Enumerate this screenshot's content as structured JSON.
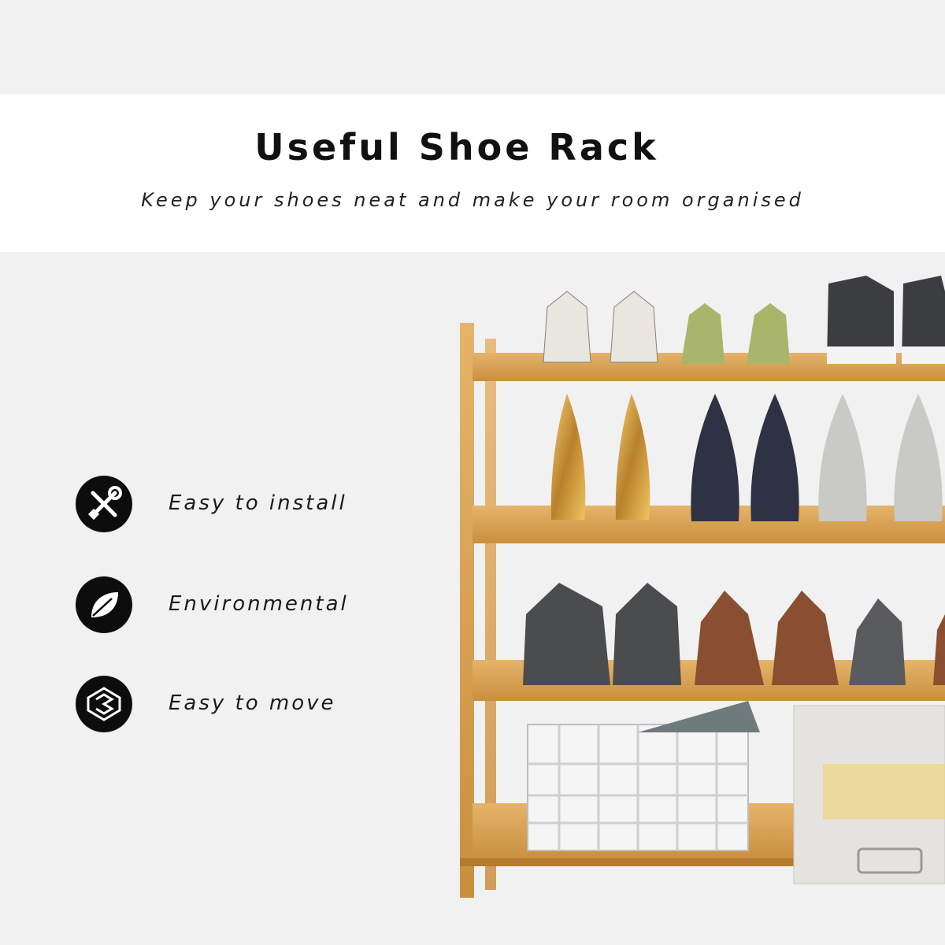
{
  "header": {
    "title": "Useful Shoe Rack",
    "subtitle": "Keep your shoes neat and make your room organised"
  },
  "features": [
    {
      "label": "Easy to install",
      "icon": "tools-icon"
    },
    {
      "label": "Environmental",
      "icon": "leaf-icon"
    },
    {
      "label": "Easy to move",
      "icon": "move-icon"
    }
  ],
  "colors": {
    "background": "#f1f1f1",
    "banner": "#ffffff",
    "icon_circle": "#0d0d0d",
    "bamboo": "#d9a55a"
  },
  "product": {
    "name": "4-tier bamboo shoe rack"
  }
}
